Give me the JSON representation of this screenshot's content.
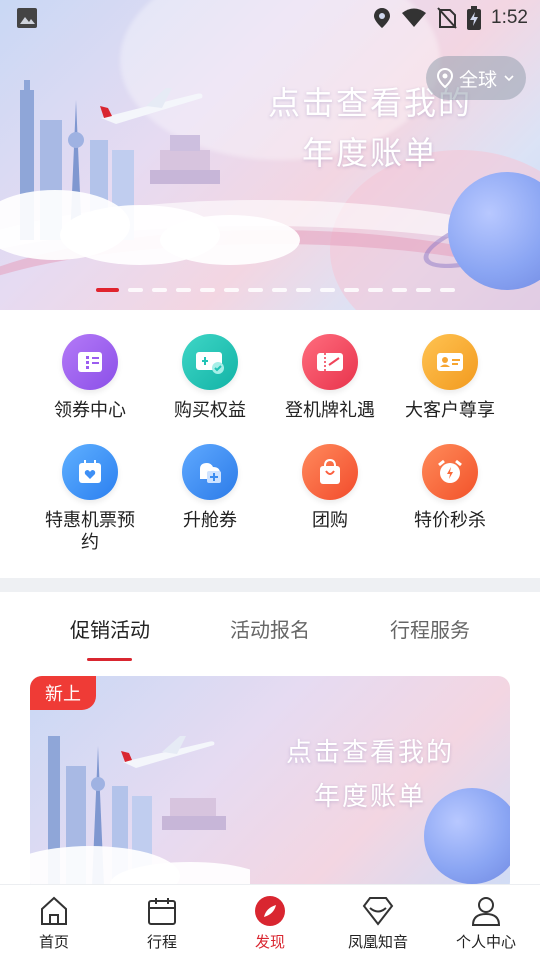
{
  "status_bar": {
    "time": "1:52",
    "icons": [
      "image-icon",
      "location-icon",
      "wifi-icon",
      "no-sim-icon",
      "battery-charging-icon"
    ]
  },
  "banner": {
    "headline_line1": "点击查看我的",
    "headline_line2": "年度账单",
    "region_label": "全球",
    "slide_count": 15,
    "active_slide": 0
  },
  "grid": {
    "items": [
      {
        "label": "领券中心",
        "icon": "coupon-icon",
        "color": "#9b5cf0"
      },
      {
        "label": "购买权益",
        "icon": "benefits-icon",
        "color": "#22c3b6"
      },
      {
        "label": "登机牌礼遇",
        "icon": "boarding-pass-icon",
        "color": "#f0445a"
      },
      {
        "label": "大客户尊享",
        "icon": "vip-card-icon",
        "color": "#f7a530"
      },
      {
        "label": "特惠机票预约",
        "icon": "calendar-heart-icon",
        "color": "#3d8ff5"
      },
      {
        "label": "升舱券",
        "icon": "upgrade-icon",
        "color": "#3b8cf0"
      },
      {
        "label": "团购",
        "icon": "shopping-bag-icon",
        "color": "#fb5f3f"
      },
      {
        "label": "特价秒杀",
        "icon": "alarm-clock-icon",
        "color": "#fb6a3a"
      }
    ]
  },
  "tabs": [
    {
      "label": "促销活动",
      "active": true
    },
    {
      "label": "活动报名",
      "active": false
    },
    {
      "label": "行程服务",
      "active": false
    }
  ],
  "promo": {
    "badge": "新上",
    "headline_line1": "点击查看我的",
    "headline_line2": "年度账单"
  },
  "bottom_nav": [
    {
      "label": "首页",
      "icon": "home-icon",
      "active": false
    },
    {
      "label": "行程",
      "icon": "calendar-icon",
      "active": false
    },
    {
      "label": "发现",
      "icon": "compass-icon",
      "active": true
    },
    {
      "label": "凤凰知音",
      "icon": "diamond-icon",
      "active": false
    },
    {
      "label": "个人中心",
      "icon": "person-icon",
      "active": false
    }
  ],
  "colors": {
    "accent": "#d92630"
  }
}
